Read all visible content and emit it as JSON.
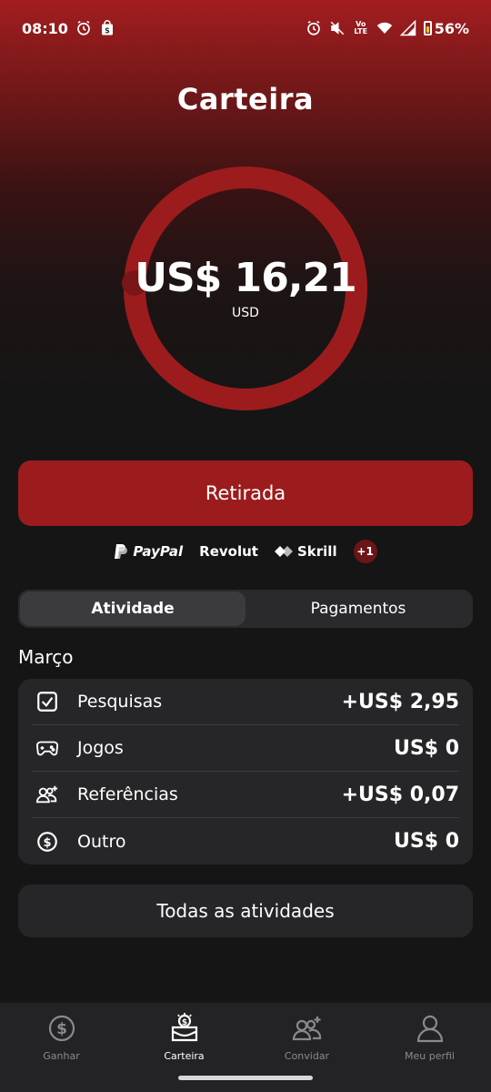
{
  "status_bar": {
    "time": "08:10",
    "network_label": "Vo LTE",
    "battery_percent": "56%",
    "battery_level": 0.56,
    "left_icons": [
      "alarm-icon",
      "shopping-bag-icon"
    ],
    "right_icons": [
      "alarm-icon",
      "mute-icon",
      "volte-icon",
      "wifi-icon",
      "signal-icon",
      "battery-icon"
    ]
  },
  "page": {
    "title": "Carteira"
  },
  "balance": {
    "amount": "US$ 16,21",
    "unit": "USD",
    "ring_color": "#9c1c1e"
  },
  "withdraw": {
    "label": "Retirada"
  },
  "providers": {
    "paypal": "PayPal",
    "revolut": "Revolut",
    "skrill": "Skrill",
    "more": "+1"
  },
  "tabs": [
    {
      "label": "Atividade",
      "active": true
    },
    {
      "label": "Pagamentos",
      "active": false
    }
  ],
  "activity": {
    "month": "Março",
    "rows": [
      {
        "icon": "checkbox-icon",
        "label": "Pesquisas",
        "value": "+US$ 2,95"
      },
      {
        "icon": "gamepad-icon",
        "label": "Jogos",
        "value": "US$ 0"
      },
      {
        "icon": "add-users-icon",
        "label": "Referências",
        "value": "+US$ 0,07"
      },
      {
        "icon": "dollar-coin-icon",
        "label": "Outro",
        "value": "US$ 0"
      }
    ],
    "all_label": "Todas as atividades"
  },
  "nav": [
    {
      "icon": "dollar-coin-icon",
      "label": "Ganhar",
      "active": false
    },
    {
      "icon": "wallet-icon",
      "label": "Carteira",
      "active": true
    },
    {
      "icon": "add-users-icon",
      "label": "Convidar",
      "active": false
    },
    {
      "icon": "user-icon",
      "label": "Meu perfil",
      "active": false
    }
  ],
  "colors": {
    "accent": "#9c1c1e",
    "background": "#151515",
    "card": "#262628"
  }
}
